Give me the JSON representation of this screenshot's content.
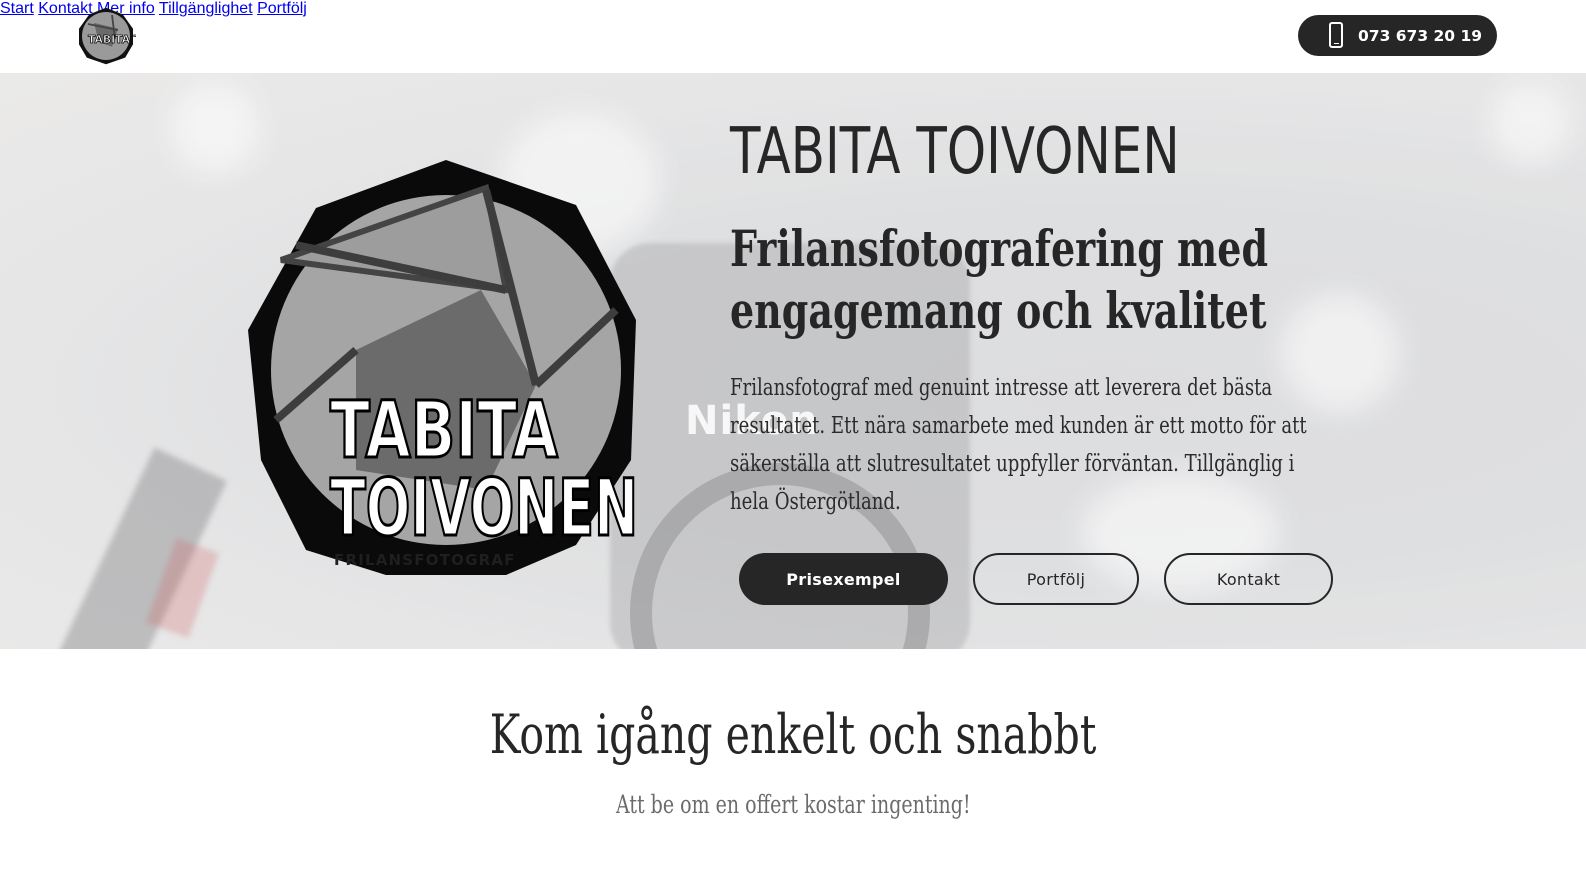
{
  "header": {
    "logo_alt_text": "TABITA TOIVONEN",
    "nav": [
      {
        "label": "Start"
      },
      {
        "label": "Kontakt"
      },
      {
        "label": "Mer info"
      },
      {
        "label": "Tillgänglighet"
      },
      {
        "label": "Portfölj"
      }
    ],
    "phone": {
      "icon": "phone-icon",
      "label": "073 673 20 19"
    }
  },
  "hero": {
    "logo": {
      "line1": "TABITA",
      "line2": "TOIVONEN",
      "tagline": "FRILANSFOTOGRAF"
    },
    "background_brand_text": "Nikon",
    "title": "TABITA TOIVONEN",
    "subtitle_line1": "Frilansfotografering med",
    "subtitle_line2": "engagemang och kvalitet",
    "description": "Frilansfotograf med genuint intresse att leverera det bästa resultatet. Ett nära samarbete med kunden är ett motto för att säkerställa att slutresultatet uppfyller förväntan. Tillgänglig i hela Östergötland.",
    "buttons": {
      "primary": "Prisexempel",
      "portfolio": "Portfölj",
      "contact": "Kontakt"
    }
  },
  "section": {
    "title": "Kom igång enkelt och snabbt",
    "subtitle": "Att be om en offert kostar ingenting!"
  },
  "colors": {
    "dark": "#262626",
    "white": "#ffffff",
    "muted_text": "#6b6b6b"
  }
}
